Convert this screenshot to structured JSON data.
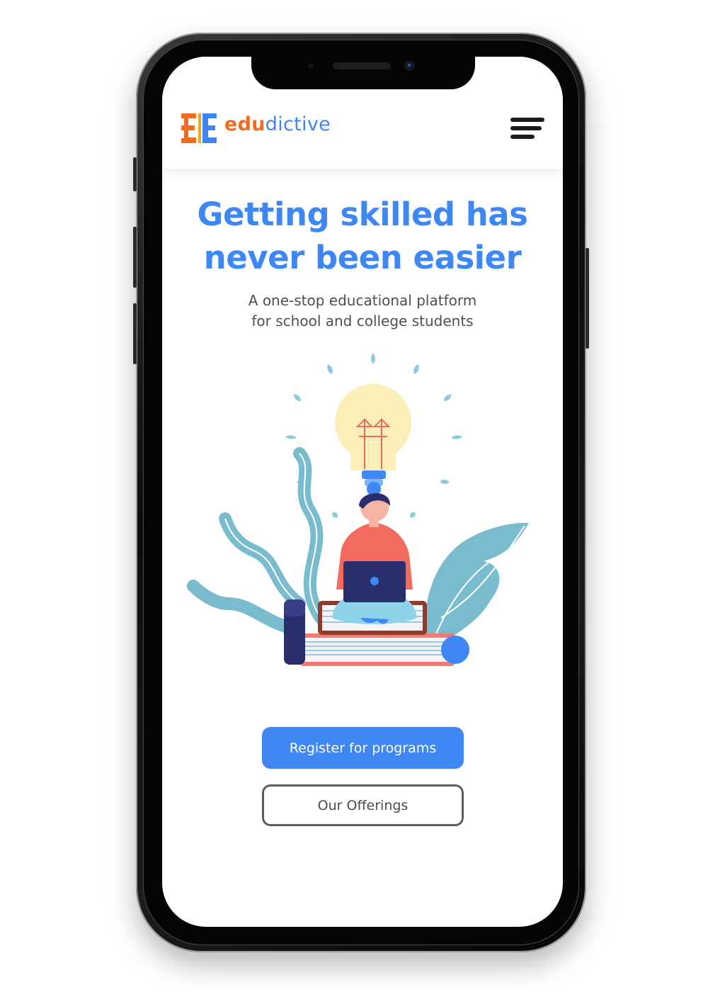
{
  "brand": {
    "logo_icon": "edudictive-logo-icon",
    "name_part1": "edu",
    "name_part2": "dictive",
    "colors": {
      "orange": "#f26b22",
      "blue": "#3f86f4"
    }
  },
  "header": {
    "menu_icon": "hamburger-menu-icon"
  },
  "hero": {
    "title_line1": "Getting skilled has",
    "title_line2": "never been easier",
    "subtitle_line1": "A one-stop educational platform",
    "subtitle_line2": "for school and college students",
    "illustration": "student-with-laptop-on-books-lightbulb-illustration"
  },
  "actions": {
    "primary_label": "Register for programs",
    "secondary_label": "Our Offerings"
  },
  "theme": {
    "accent": "#3f87f5",
    "text_dark": "#4f4f4f",
    "border": "#5e5e5e"
  }
}
